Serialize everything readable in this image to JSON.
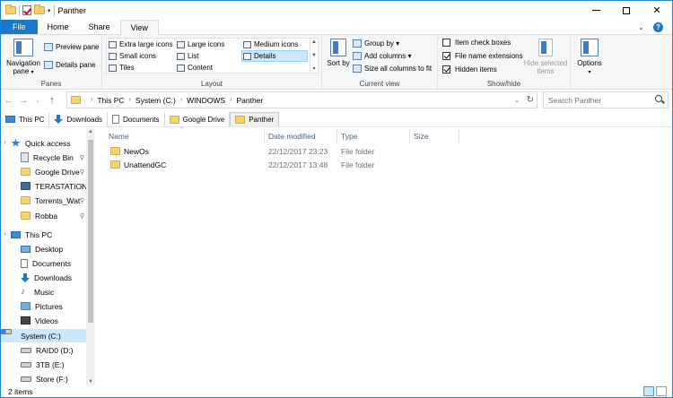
{
  "window": {
    "title": "Panther"
  },
  "tabs": [
    "File",
    "Home",
    "Share",
    "View"
  ],
  "ribbon": {
    "panes": {
      "label": "Panes",
      "navigation_pane": "Navigation pane",
      "preview_pane": "Preview pane",
      "details_pane": "Details pane"
    },
    "layout": {
      "label": "Layout",
      "items": [
        "Extra large icons",
        "Large icons",
        "Medium icons",
        "Small icons",
        "List",
        "Details",
        "Tiles",
        "Content"
      ],
      "selected": "Details"
    },
    "current_view": {
      "label": "Current view",
      "sort_by": "Sort by",
      "group_by": "Group by",
      "add_columns": "Add columns",
      "size_all": "Size all columns to fit"
    },
    "show_hide": {
      "label": "Show/hide",
      "item_check_boxes": "Item check boxes",
      "item_check_boxes_checked": false,
      "file_name_extensions": "File name extensions",
      "file_name_extensions_checked": true,
      "hidden_items": "Hidden items",
      "hidden_items_checked": true,
      "hide_selected": "Hide selected items"
    },
    "options": {
      "label": "Options"
    }
  },
  "address": {
    "crumbs": [
      "This PC",
      "System (C:)",
      "WINDOWS",
      "Panther"
    ],
    "search_placeholder": "Search Panther"
  },
  "favorites": [
    "This PC",
    "Downloads",
    "Documents",
    "Google Drive",
    "Panther"
  ],
  "nav": {
    "quick_access": "Quick access",
    "quick_items": [
      "Recycle Bin",
      "Google Drive",
      "TERASTATION",
      "Torrents_Wat",
      "Robba"
    ],
    "this_pc": "This PC",
    "pc_items": [
      "Desktop",
      "Documents",
      "Downloads",
      "Music",
      "Pictures",
      "Videos",
      "System (C:)",
      "RAID0 (D:)",
      "3TB (E:)",
      "Store (F:)"
    ]
  },
  "columns": {
    "name": "Name",
    "date": "Date modified",
    "type": "Type",
    "size": "Size"
  },
  "files": [
    {
      "name": "NewOs",
      "date": "22/12/2017 23:23",
      "type": "File folder"
    },
    {
      "name": "UnattendGC",
      "date": "22/12/2017 13:48",
      "type": "File folder"
    }
  ],
  "status": {
    "count": "2 items"
  },
  "icons": [
    "folder-icon",
    "star-icon",
    "pin-icon",
    "search-icon",
    "refresh-icon",
    "drive-icon"
  ],
  "colors": {
    "accent": "#1979ca",
    "selection": "#cce8ff"
  }
}
